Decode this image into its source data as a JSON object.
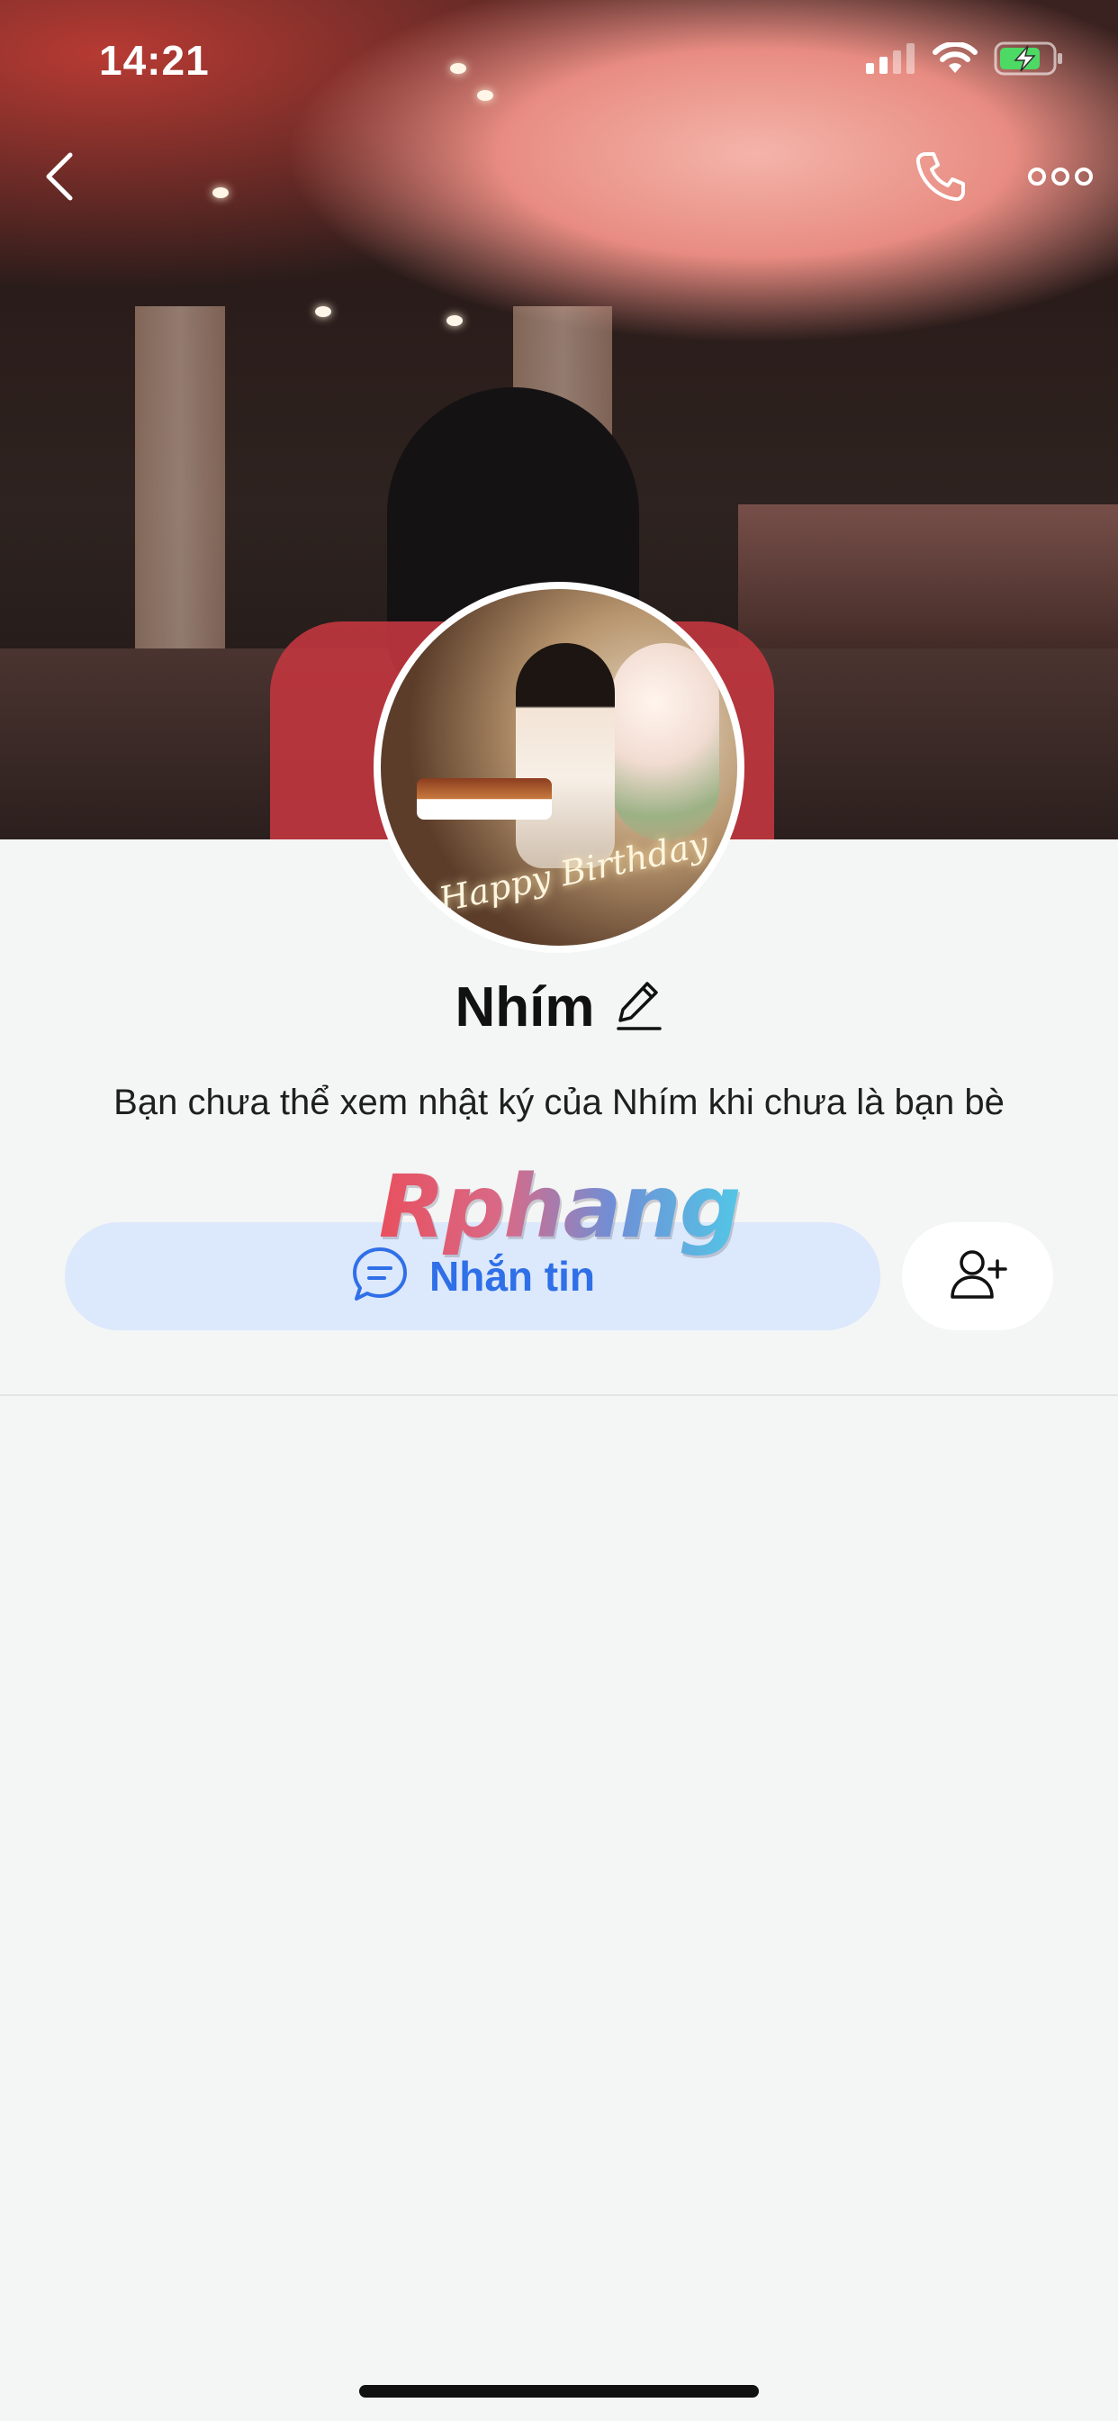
{
  "status_bar": {
    "time": "14:21",
    "signal_icon": "cellular-signal-icon",
    "wifi_icon": "wifi-icon",
    "battery_icon": "battery-charging-icon",
    "battery_color": "#4cd964"
  },
  "nav": {
    "back_icon": "chevron-left-icon",
    "call_icon": "phone-icon",
    "more_icon": "more-horizontal-icon"
  },
  "cover": {
    "avatar_neon_text": "Happy Birthday"
  },
  "profile": {
    "name": "Nhím",
    "edit_icon": "pencil-icon",
    "notice": "Bạn chưa thể xem nhật ký của Nhím khi chưa là bạn bè"
  },
  "watermark": {
    "text": "Rphang"
  },
  "actions": {
    "message_label": "Nhắn tin",
    "message_icon": "chat-bubble-icon",
    "add_friend_icon": "add-friend-icon"
  },
  "colors": {
    "accent": "#2f6fe8",
    "message_button_bg": "#dce8fb",
    "page_bg": "#f4f5f5"
  }
}
